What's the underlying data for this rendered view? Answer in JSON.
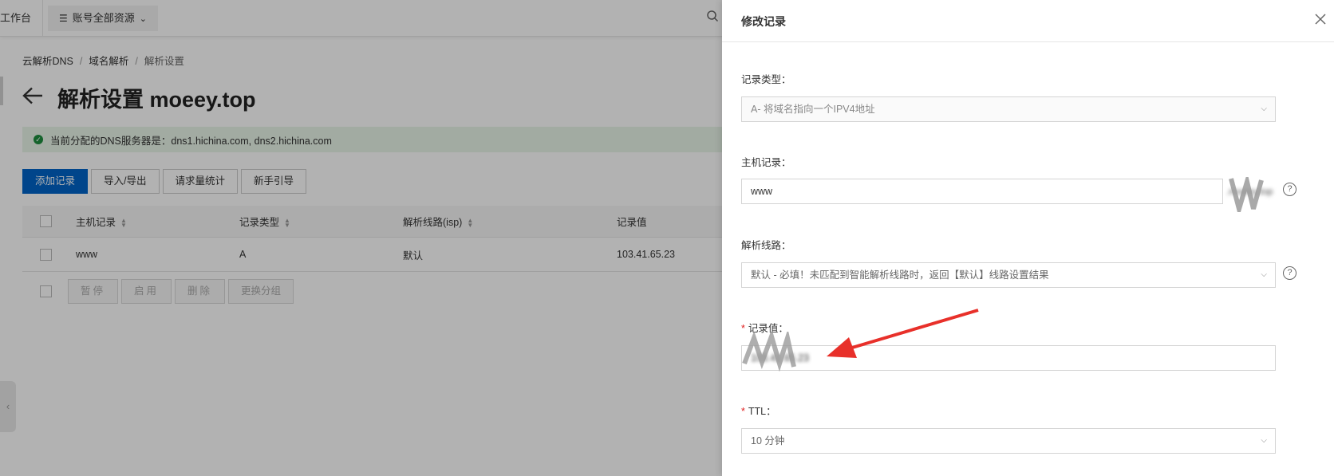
{
  "topbar": {
    "workbench_label": "工作台",
    "resources_label": "账号全部资源",
    "resources_icon": "list-icon",
    "search_icon": "search-icon"
  },
  "breadcrumb": [
    "云解析DNS",
    "域名解析",
    "解析设置"
  ],
  "page": {
    "title": "解析设置 moeey.top",
    "notice": "当前分配的DNS服务器是：dns1.hichina.com, dns2.hichina.com"
  },
  "toolbar": {
    "add_record": "添加记录",
    "import_export": "导入/导出",
    "request_stats": "请求量统计",
    "guide": "新手引导"
  },
  "table": {
    "headers": [
      "主机记录",
      "记录类型",
      "解析线路(isp)",
      "记录值"
    ],
    "rows": [
      {
        "host": "www",
        "type": "A",
        "line": "默认",
        "value": "103.41.65.23"
      }
    ]
  },
  "batch": {
    "pause": "暂停",
    "enable": "启用",
    "delete": "删除",
    "change_group": "更换分组"
  },
  "drawer": {
    "title": "修改记录",
    "record_type_label": "记录类型：",
    "record_type_value": "A- 将域名指向一个IPV4地址",
    "host_label": "主机记录：",
    "host_value": "www",
    "host_suffix": ".moeey.top",
    "line_label": "解析线路：",
    "line_value": "默认 - 必填！未匹配到智能解析线路时，返回【默认】线路设置结果",
    "value_label": "记录值：",
    "value_value": "103.41.65.23",
    "ttl_label": "TTL：",
    "ttl_value": "10 分钟"
  },
  "colors": {
    "primary": "#0064c8",
    "success_bg": "#e9f5e9",
    "required": "#e02020",
    "annotation_arrow": "#e8302a"
  }
}
